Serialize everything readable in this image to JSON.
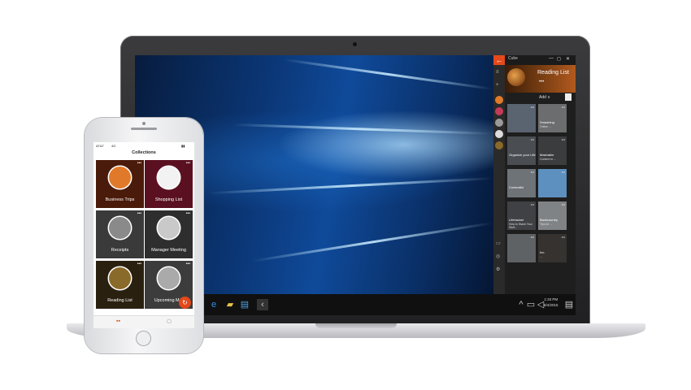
{
  "laptop": {
    "app": {
      "title": "Cube",
      "window_controls": [
        "—",
        "◻",
        "✕"
      ],
      "back_icon": "←",
      "collection_name": "Reading List",
      "collection_more": "•••",
      "add_label": "Add",
      "add_chevron": "∨",
      "tiles": [
        {
          "title": "",
          "desc": "",
          "color": "#5a6470"
        },
        {
          "title": "Smashing",
          "desc": "Online ...",
          "color": "#6b6d6e"
        },
        {
          "title": "Organize your Life",
          "desc": "",
          "color": "#4a4e52"
        },
        {
          "title": "Mashable",
          "desc": "Content to ...",
          "color": "#3a3c3e"
        },
        {
          "title": "Contentful",
          "desc": "",
          "color": "#6e7378"
        },
        {
          "title": "",
          "desc": "",
          "color": "#5d8fbf"
        },
        {
          "title": "Lifehacker",
          "desc": "How to Stash Your Stuff...",
          "color": "#3f4144"
        },
        {
          "title": "Backcountry",
          "desc": "Tips for ...",
          "color": "#808385"
        },
        {
          "title": "",
          "desc": "",
          "color": "#5f6265"
        },
        {
          "title": "Inc.",
          "desc": "...",
          "color": "#363230"
        }
      ]
    },
    "taskbar": {
      "time": "1:33 PM",
      "date": "8/4/2015"
    }
  },
  "phone": {
    "status": {
      "carrier": "AT&T",
      "network": "4G",
      "time": "",
      "battery": "▮▮"
    },
    "title": "Collections",
    "cards": [
      {
        "label": "Business Trips",
        "bg": "#4a1a0a",
        "circle": "#e07a2a"
      },
      {
        "label": "Shopping List",
        "bg": "#5a1020",
        "circle": "#f2f2f2"
      },
      {
        "label": "Receipts",
        "bg": "#3a3a3a",
        "circle": "#8a8a8a"
      },
      {
        "label": "Manager Meeting",
        "bg": "#2e2e2e",
        "circle": "#c9c9c9"
      },
      {
        "label": "Reading List",
        "bg": "#2a2010",
        "circle": "#8a6a2a"
      },
      {
        "label": "Upcoming M...",
        "bg": "#3c3c3c",
        "circle": "#aaaaaa"
      }
    ],
    "tabs": [
      "▪▪",
      "⎔"
    ],
    "fab_icon": "↻"
  }
}
